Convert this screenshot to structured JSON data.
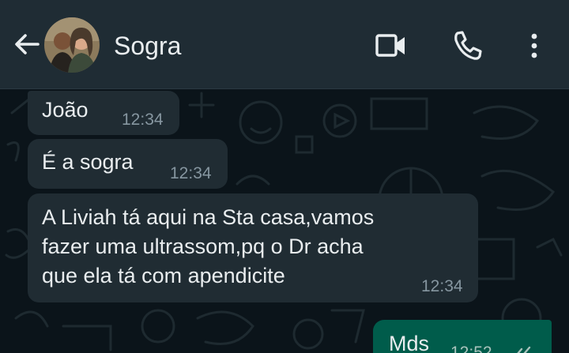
{
  "header": {
    "contact_name": "Sogra",
    "icons": [
      "back-arrow-icon",
      "video-call-icon",
      "voice-call-icon",
      "more-options-icon"
    ]
  },
  "colors": {
    "header_bg": "#1f2c34",
    "chat_bg": "#0b141a",
    "incoming_bubble": "#202c33",
    "outgoing_bubble": "#005c4b",
    "text": "#e9edef",
    "timestamp": "#8696a0"
  },
  "messages": [
    {
      "direction": "incoming",
      "text": "João",
      "time": "12:34"
    },
    {
      "direction": "incoming",
      "text": "É a sogra",
      "time": "12:34"
    },
    {
      "direction": "incoming",
      "lines": [
        "A Liviah tá aqui na Sta casa,vamos",
        "fazer uma ultrassom,pq o Dr acha",
        "que ela tá com apendicite"
      ],
      "time": "12:34"
    },
    {
      "direction": "outgoing",
      "text": "Mds",
      "time": "12:52",
      "status": "read-double-check-icon"
    }
  ]
}
